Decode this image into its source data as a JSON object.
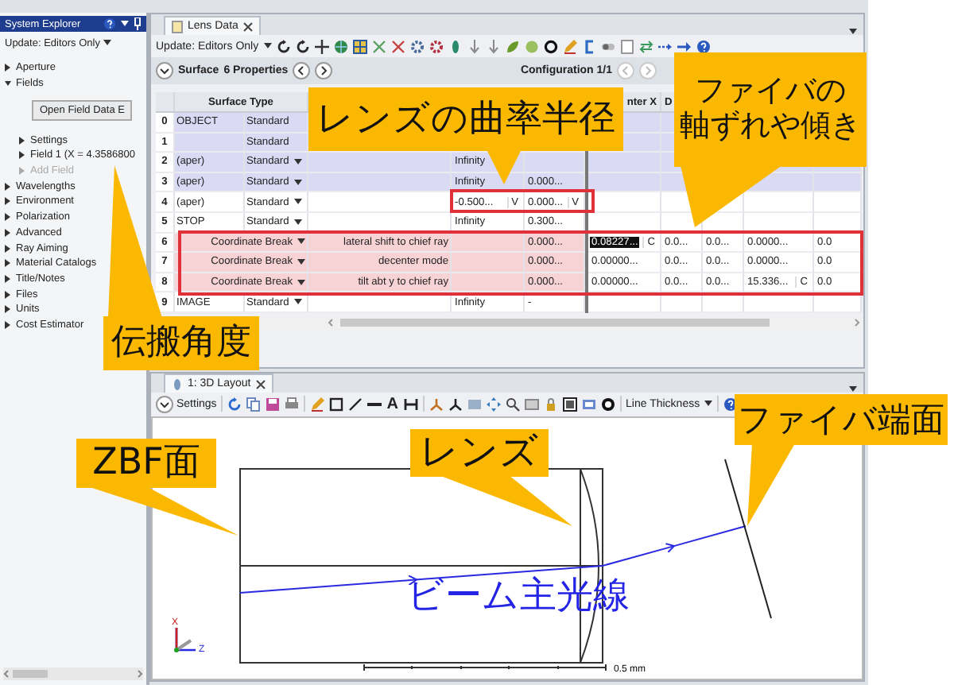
{
  "sidebar": {
    "title": "System Explorer",
    "update": "Update: Editors Only",
    "items": [
      {
        "label": "Aperture",
        "expanded": false
      },
      {
        "label": "Fields",
        "expanded": true,
        "button": "Open Field Data E",
        "children": [
          {
            "label": "Settings",
            "disabled": false
          },
          {
            "label": "Field 1 (X = 4.3586800",
            "disabled": false
          },
          {
            "label": "Add Field",
            "disabled": true
          }
        ]
      },
      {
        "label": "Wavelengths",
        "expanded": false
      },
      {
        "label": "Environment",
        "expanded": false
      },
      {
        "label": "Polarization",
        "expanded": false
      },
      {
        "label": "Advanced",
        "expanded": false
      },
      {
        "label": "Ray Aiming",
        "expanded": false
      },
      {
        "label": "Material Catalogs",
        "expanded": false
      },
      {
        "label": "Title/Notes",
        "expanded": false
      },
      {
        "label": "Files",
        "expanded": false
      },
      {
        "label": "Units",
        "expanded": false
      },
      {
        "label": "Cost Estimator",
        "expanded": false
      }
    ]
  },
  "lens_data": {
    "tab": "Lens Data",
    "update": "Update: Editors Only",
    "surface": "Surface",
    "properties": "6 Properties",
    "configuration": "Configuration 1/1",
    "columns": [
      {
        "label": "Surface Type",
        "kind": "type"
      },
      {
        "label": "nter X",
        "kind": "param"
      },
      {
        "label": "D",
        "kind": "param"
      }
    ],
    "rows": [
      {
        "number": "0",
        "kind": "standard",
        "color": "#dadaf5",
        "comment": "OBJECT",
        "type": "Standard",
        "dropdown": false
      },
      {
        "number": "1",
        "kind": "standard",
        "color": "#dadaf5",
        "type": "Standard",
        "dropdown": false
      },
      {
        "number": "2",
        "kind": "standard",
        "color": "#dadaf5",
        "comment": "(aper)",
        "type": "Standard",
        "dropdown": true,
        "radius": "Infinity"
      },
      {
        "number": "3",
        "kind": "standard",
        "color": "#dadaf5",
        "comment": "(aper)",
        "type": "Standard",
        "dropdown": true,
        "radius": "Infinity",
        "thickness": "0.000..."
      },
      {
        "number": "4",
        "kind": "standard",
        "color": "#ffffff",
        "comment": "(aper)",
        "type": "Standard",
        "dropdown": true,
        "radius": "-0.500...",
        "radius_solve": "V",
        "thickness": "0.000...",
        "thickness_solve": "V"
      },
      {
        "number": "5",
        "kind": "standard",
        "color": "#ffffff",
        "comment": "STOP",
        "type": "Standard",
        "dropdown": true,
        "radius": "Infinity",
        "thickness": "0.300..."
      },
      {
        "number": "6",
        "kind": "coordinate_break",
        "color": "#f8d3d6",
        "type": "Coordinate Break",
        "dropdown": true,
        "note": "lateral shift to chief ray",
        "thickness": "0.000...",
        "params": [
          {
            "value": "0.08227...",
            "solve": "C",
            "selected": true
          },
          {
            "value": "0.0...",
            "selected": false
          },
          {
            "value": "0.0...",
            "selected": false
          },
          {
            "value": "0.0000...",
            "selected": false
          },
          {
            "value": "0.0",
            "selected": false
          }
        ]
      },
      {
        "number": "7",
        "kind": "coordinate_break",
        "color": "#f8d3d6",
        "type": "Coordinate Break",
        "dropdown": true,
        "note": "decenter mode",
        "thickness": "0.000...",
        "params": [
          {
            "value": "0.00000...",
            "selected": false
          },
          {
            "value": "0.0...",
            "selected": false
          },
          {
            "value": "0.0...",
            "selected": false
          },
          {
            "value": "0.0000...",
            "selected": false
          },
          {
            "value": "0.0",
            "selected": false
          }
        ]
      },
      {
        "number": "8",
        "kind": "coordinate_break",
        "color": "#f8d3d6",
        "type": "Coordinate Break",
        "dropdown": true,
        "note": "tilt abt y to chief ray",
        "thickness": "0.000...",
        "params": [
          {
            "value": "0.00000...",
            "selected": false
          },
          {
            "value": "0.0...",
            "selected": false
          },
          {
            "value": "0.0...",
            "selected": false
          },
          {
            "value": "15.336...",
            "solve": "C",
            "selected": false
          },
          {
            "value": "0.0",
            "selected": false
          }
        ]
      },
      {
        "number": "9",
        "kind": "standard",
        "color": "#ffffff",
        "comment": "IMAGE",
        "type": "Standard",
        "dropdown": true,
        "radius": "Infinity",
        "thickness": "-"
      }
    ]
  },
  "layout_3d": {
    "tab": "1: 3D Layout",
    "settings": "Settings",
    "text_tool": "A",
    "line_thickness": "Line Thickness",
    "axes": [
      "X",
      "Z"
    ],
    "scale": "0.5 mm",
    "beam_label": "ビーム主光線"
  },
  "callouts": [
    {
      "lines": [
        "レンズの曲率半径"
      ]
    },
    {
      "lines": [
        "ファイバの",
        "軸ずれや傾き"
      ]
    },
    {
      "lines": [
        "伝搬角度"
      ]
    },
    {
      "lines": [
        "ファイバ端面"
      ]
    },
    {
      "lines": [
        "ZBF面"
      ]
    },
    {
      "lines": [
        "レンズ"
      ]
    }
  ]
}
